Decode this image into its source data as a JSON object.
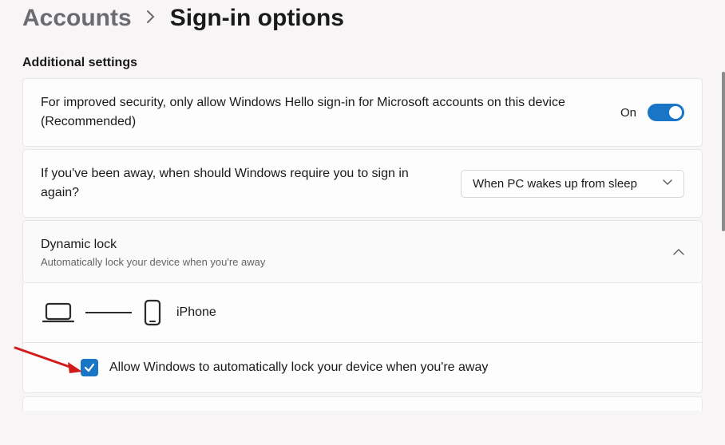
{
  "breadcrumb": {
    "parent": "Accounts",
    "current": "Sign-in options"
  },
  "section": {
    "title": "Additional settings"
  },
  "hello_card": {
    "text": "For improved security, only allow Windows Hello sign-in for Microsoft accounts on this device (Recommended)",
    "state_label": "On"
  },
  "reauth_card": {
    "text": "If you've been away, when should Windows require you to sign in again?",
    "selected": "When PC wakes up from sleep"
  },
  "dynamic_lock": {
    "title": "Dynamic lock",
    "subtitle": "Automatically lock your device when you're away",
    "paired_device": "iPhone",
    "checkbox_label": "Allow Windows to automatically lock your device when you're away"
  }
}
